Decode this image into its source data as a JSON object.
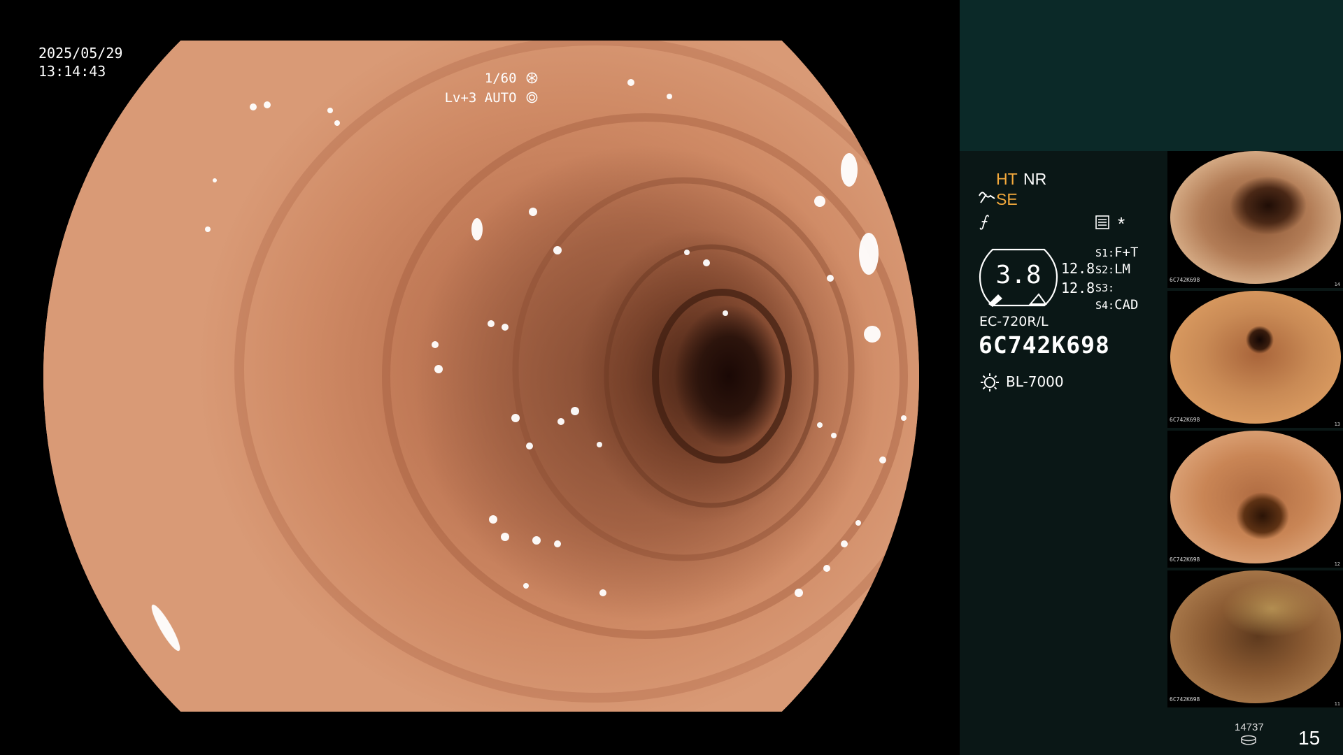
{
  "overlay": {
    "date": "2025/05/29",
    "time": "13:14:43",
    "shutter": "1/60",
    "level": "Lv+3 AUTO"
  },
  "panel": {
    "mode_ht": "HT",
    "mode_nr": "NR",
    "mode_se": "SE",
    "mode_f_symbol": "⨍",
    "asterisk": "*",
    "gauge_value": "3.8",
    "gauge_side_1": "12.8",
    "gauge_side_2": "12.8",
    "switches": [
      {
        "key": "S1:",
        "value": "F+T"
      },
      {
        "key": "S2:",
        "value": "LM"
      },
      {
        "key": "S3:",
        "value": ""
      },
      {
        "key": "S4:",
        "value": "CAD"
      }
    ],
    "scope_model": "EC-720R/L",
    "scope_serial": "6C742K698",
    "light_source": "BL-7000"
  },
  "thumbnails": [
    {
      "caption_line1": "6C742K698",
      "index": "14"
    },
    {
      "caption_line1": "6C742K698",
      "index": "13"
    },
    {
      "caption_line1": "6C742K698",
      "index": "12"
    },
    {
      "caption_line1": "6C742K698",
      "index": "11"
    }
  ],
  "footer": {
    "storage_count": "14737",
    "image_count": "15"
  },
  "colors": {
    "accent_orange": "#f3a93c",
    "panel_top": "#0b2928",
    "panel_body": "#0a1716"
  }
}
